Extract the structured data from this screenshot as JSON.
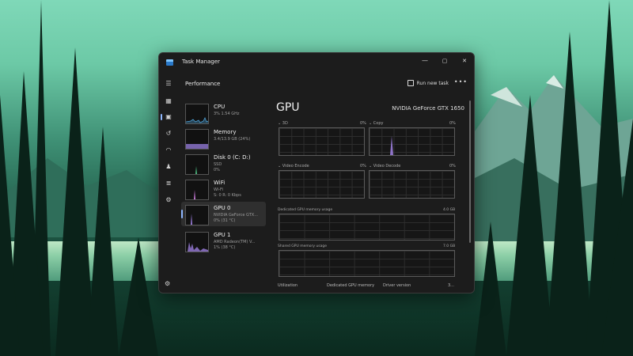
{
  "window": {
    "title": "Task Manager",
    "minimize": "—",
    "maximize": "▢",
    "close": "✕"
  },
  "header": {
    "title": "Performance",
    "run_new_task": "Run new task",
    "more": "•••"
  },
  "sidebar_icons": [
    "menu-icon",
    "processes-icon",
    "performance-icon",
    "app-history-icon",
    "startup-icon",
    "users-icon",
    "details-icon",
    "services-icon",
    "settings-icon"
  ],
  "devices": [
    {
      "name": "CPU",
      "sub1": "3%  1.54 GHz",
      "sub2": ""
    },
    {
      "name": "Memory",
      "sub1": "3.4/13.9 GB (24%)",
      "sub2": ""
    },
    {
      "name": "Disk 0 (C: D:)",
      "sub1": "SSD",
      "sub2": "0%"
    },
    {
      "name": "WiFi",
      "sub1": "Wi-Fi",
      "sub2": "S: 0  R: 0 Kbps"
    },
    {
      "name": "GPU 0",
      "sub1": "NVIDIA GeForce GTX...",
      "sub2": "0%  (31 °C)"
    },
    {
      "name": "GPU 1",
      "sub1": "AMD Radeon(TM) V...",
      "sub2": "1%  (38 °C)"
    }
  ],
  "panel": {
    "title": "GPU",
    "model": "NVIDIA GeForce GTX 1650",
    "engines": [
      {
        "label": "⌄ 3D",
        "pct": "0%"
      },
      {
        "label": "⌄ Copy",
        "pct": "0%"
      },
      {
        "label": "⌄ Video Encode",
        "pct": "0%"
      },
      {
        "label": "⌄ Video Decode",
        "pct": "0%"
      }
    ],
    "dedicated_label": "Dedicated GPU memory usage",
    "dedicated_max": "4.0 GB",
    "shared_label": "Shared GPU memory usage",
    "shared_max": "7.0 GB",
    "bottom_labels": [
      "Utilization",
      "Dedicated GPU memory",
      "Driver version",
      "3..."
    ]
  },
  "colors": {
    "accent": "#8fb7ff",
    "cpu": "#4fa3d8",
    "memory": "#9a7fe0",
    "disk": "#4fbf84",
    "wifi": "#c77ad6",
    "gpu": "#9b7ddc"
  }
}
